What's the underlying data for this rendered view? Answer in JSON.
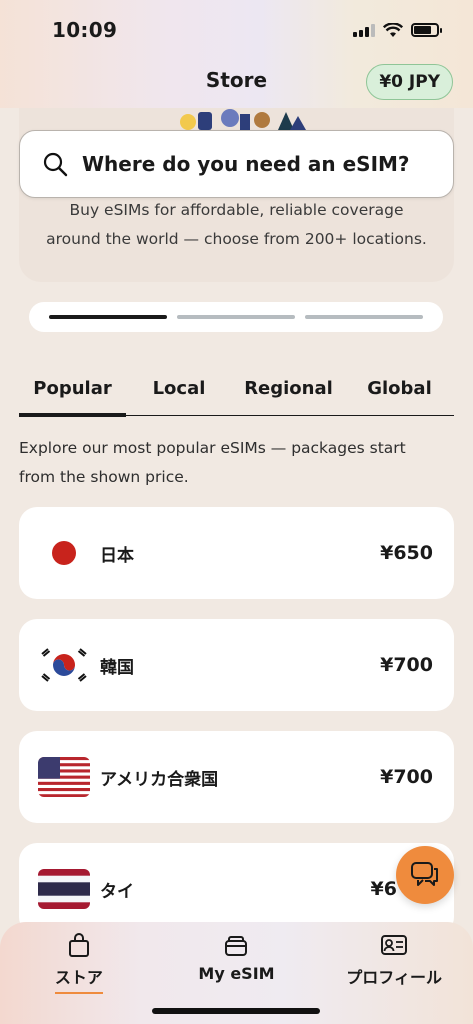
{
  "status_bar": {
    "time": "10:09"
  },
  "header": {
    "title": "Store",
    "balance": "¥0 JPY"
  },
  "hero": {
    "search_placeholder": "Where do you need an eSIM?",
    "description_line1": "Buy eSIMs for affordable, reliable coverage",
    "description_line2": "around the world — choose from 200+ locations.",
    "carousel_active_index": 0,
    "carousel_count": 3
  },
  "tabs": [
    {
      "label": "Popular",
      "active": true
    },
    {
      "label": "Local",
      "active": false
    },
    {
      "label": "Regional",
      "active": false
    },
    {
      "label": "Global",
      "active": false
    }
  ],
  "intro": {
    "line1": "Explore our most popular eSIMs — packages start",
    "line2": "from the shown price."
  },
  "countries": [
    {
      "name": "日本",
      "price": "¥650",
      "flag": "japan-flag-icon"
    },
    {
      "name": "韓国",
      "price": "¥700",
      "flag": "korea-flag-icon"
    },
    {
      "name": "アメリカ合衆国",
      "price": "¥700",
      "flag": "usa-flag-icon"
    },
    {
      "name": "タイ",
      "price": "¥6",
      "flag": "thailand-flag-icon"
    }
  ],
  "bottom_nav": [
    {
      "label": "ストア",
      "icon": "shopping-bag-icon",
      "active": true
    },
    {
      "label": "My eSIM",
      "icon": "sim-stack-icon",
      "active": false
    },
    {
      "label": "プロフィール",
      "icon": "id-card-icon",
      "active": false
    }
  ],
  "colors": {
    "accent": "#ef8b3d",
    "balance_bg": "#d9efda",
    "page_bg": "#f1e9e2"
  }
}
